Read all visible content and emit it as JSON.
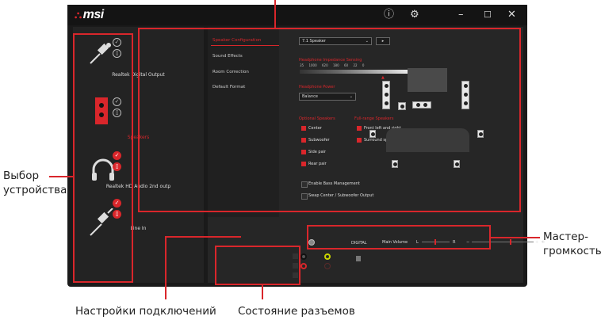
{
  "callouts": {
    "device_select": "Выбор\nустройства",
    "master_volume": "Мастер-\nгромкость",
    "connection_settings": "Настройки подключений",
    "jack_status": "Состояние разъемов"
  },
  "app": {
    "logo": "msi",
    "title_icons": [
      "info-icon",
      "gear-icon",
      "minimize-icon",
      "maximize-icon",
      "close-icon"
    ]
  },
  "devices": [
    {
      "label": "Realtek Digital Output",
      "icon": "digital-plug-icon",
      "status": "inactive"
    },
    {
      "label": "Speakers",
      "icon": "speaker-icon",
      "status": "selected"
    },
    {
      "label": "Realtek HD Audio 2nd outp",
      "icon": "headphones-icon",
      "status": "active"
    },
    {
      "label": "Line In",
      "icon": "line-in-cable-icon",
      "status": "active"
    }
  ],
  "tabs": [
    "Speaker Configuration",
    "Sound Effects",
    "Room Correction",
    "Default Format"
  ],
  "config": {
    "speaker_select": "7.1 Speaker",
    "impedance_title": "Headphone Impedance Sensing",
    "impedance_scale": [
      "35",
      "1000",
      "620",
      "180",
      "60",
      "22",
      "0"
    ],
    "power_title": "Headphone Power",
    "power_select": "Balance",
    "optional_title": "Optional Speakers",
    "optional": [
      "Center",
      "Subwoofer",
      "Side pair",
      "Rear pair"
    ],
    "fullrange_title": "Full-range Speakers",
    "fullrange": [
      "Front left and right",
      "Surround speakers"
    ],
    "bass_mgmt": "Enable Bass Management",
    "swap": "Swap Center / Subwoofer Output"
  },
  "bottom": {
    "digital_label": "DIGITAL",
    "main_volume_label": "Main Volume",
    "left": "L",
    "right": "R",
    "minus": "−",
    "plus": "+"
  },
  "colors": {
    "accent": "#d9262b",
    "panel": "#232323",
    "window": "#1a1a1a"
  }
}
